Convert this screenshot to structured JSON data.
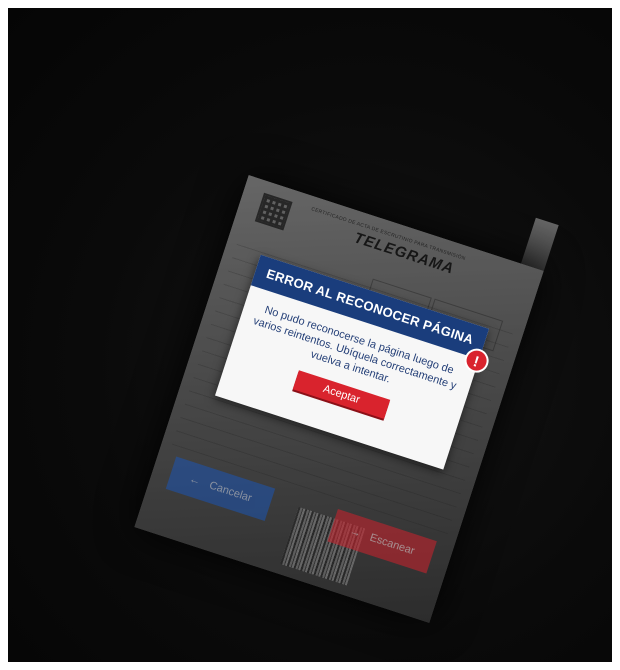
{
  "document": {
    "subtitle": "CERTIFICADO DE ACTA DE ESCRUTINIO PARA TRANSMISIÓN",
    "title": "TELEGRAMA"
  },
  "dialog": {
    "title": "ERROR AL RECONOCER PÁGINA",
    "message": "No pudo reconocerse la página luego de varios reintentos. Ubíquela correctamente y vuelva a intentar.",
    "accept_label": "Aceptar",
    "icon_glyph": "!"
  },
  "actions": {
    "cancel_label": "Cancelar",
    "cancel_arrow": "←",
    "scan_label": "Escanear",
    "scan_arrow": "→"
  },
  "colors": {
    "header_blue": "#1a3d7c",
    "accent_red": "#d9232d",
    "cancel_blue": "#1c55b3"
  }
}
